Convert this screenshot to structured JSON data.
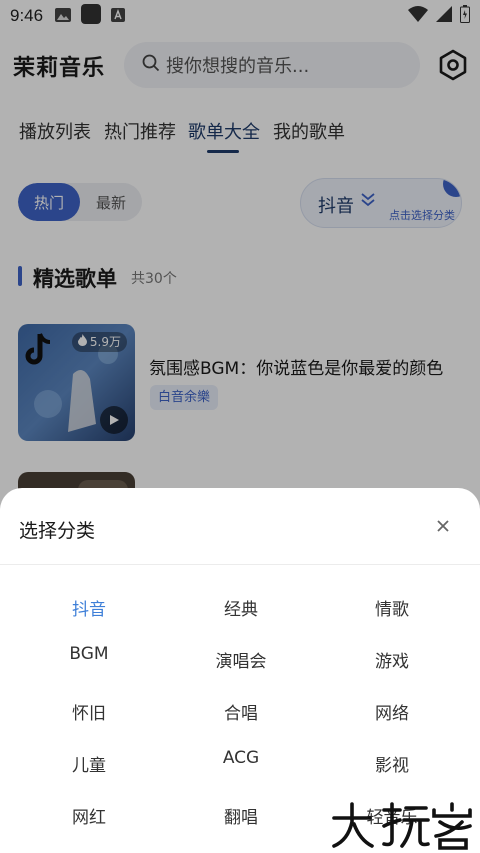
{
  "status_bar": {
    "time": "9:46"
  },
  "header": {
    "app_title": "茉莉音乐",
    "search_placeholder": "搜你想搜的音乐..."
  },
  "tabs": [
    {
      "label": "播放列表",
      "active": false
    },
    {
      "label": "热门推荐",
      "active": false
    },
    {
      "label": "歌单大全",
      "active": true
    },
    {
      "label": "我的歌单",
      "active": false
    }
  ],
  "filter": {
    "segments": [
      {
        "label": "热门",
        "active": true
      },
      {
        "label": "最新",
        "active": false
      }
    ],
    "category": {
      "label": "抖音",
      "hint": "点击选择分类"
    }
  },
  "section": {
    "title": "精选歌单",
    "count": "共30个"
  },
  "playlists": [
    {
      "title": "氛围感BGM：你说蓝色是你最爱的颜色",
      "tag": "白音余樂",
      "plays": "5.9万"
    }
  ],
  "sheet": {
    "title": "选择分类",
    "categories": [
      {
        "label": "抖音",
        "active": true
      },
      {
        "label": "经典",
        "active": false
      },
      {
        "label": "情歌",
        "active": false
      },
      {
        "label": "BGM",
        "active": false
      },
      {
        "label": "演唱会",
        "active": false
      },
      {
        "label": "游戏",
        "active": false
      },
      {
        "label": "怀旧",
        "active": false
      },
      {
        "label": "合唱",
        "active": false
      },
      {
        "label": "网络",
        "active": false
      },
      {
        "label": "儿童",
        "active": false
      },
      {
        "label": "ACG",
        "active": false
      },
      {
        "label": "影视",
        "active": false
      },
      {
        "label": "网红",
        "active": false
      },
      {
        "label": "翻唱",
        "active": false
      },
      {
        "label": "轻音乐",
        "active": false
      }
    ]
  },
  "watermark": "大玩客",
  "colors": {
    "accent": "#3e63c8",
    "active_category": "#3e7fd8",
    "tab_active": "#1f3b6b"
  }
}
